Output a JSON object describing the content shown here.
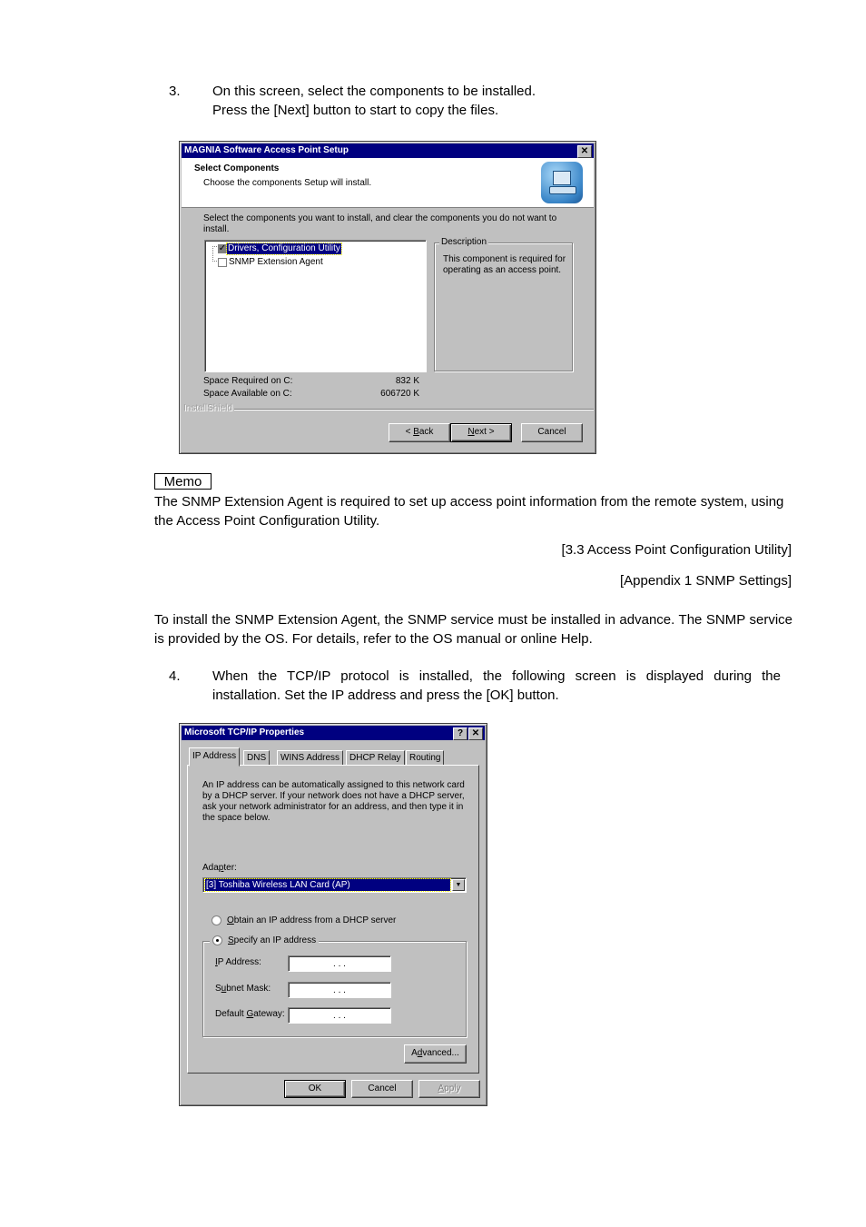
{
  "step3": {
    "number": "3.",
    "line1": "On this screen, select the components to be installed.",
    "line2": "Press the [Next] button to start to copy the files."
  },
  "setup_dialog": {
    "title": "MAGNIA Software Access Point Setup",
    "close_glyph": "✕",
    "header_title": "Select Components",
    "header_subtitle": "Choose the components Setup will install.",
    "instructions": "Select the components you want to install, and clear the components you do not want to install.",
    "components": [
      {
        "label": "Drivers, Configuration Utility",
        "checked": true,
        "selected": true
      },
      {
        "label": "SNMP Extension Agent",
        "checked": false,
        "selected": false
      }
    ],
    "description_label": "Description",
    "description_text": "This component is required for operating as an access point.",
    "space_required_label": "Space Required on  C:",
    "space_required_value": "832 K",
    "space_available_label": "Space Available on  C:",
    "space_available_value": "606720 K",
    "brand_label": "InstallShield",
    "back_button": {
      "prefix": "< ",
      "accel": "B",
      "rest": "ack"
    },
    "next_button": {
      "accel": "N",
      "rest": "ext >"
    },
    "cancel_button": "Cancel"
  },
  "memo": {
    "label": "Memo",
    "text": "The SNMP Extension Agent is required to set up access point information from the remote system, using the Access Point Configuration Utility.",
    "ref1": "[3.3 Access Point Configuration Utility]",
    "ref2": "[Appendix 1   SNMP Settings]"
  },
  "snmp_note": "To install the SNMP Extension Agent, the SNMP service must be installed in advance.  The SNMP service is provided by the OS.  For details, refer to the OS manual or online Help.",
  "step4": {
    "number": "4.",
    "line1": "When the TCP/IP protocol is installed, the following screen is displayed during the",
    "line2": "installation.  Set the IP address and press the [OK] button."
  },
  "tcpip_dialog": {
    "title": "Microsoft TCP/IP Properties",
    "help_glyph": "?",
    "close_glyph": "✕",
    "tabs": [
      "IP Address",
      "DNS",
      "WINS Address",
      "DHCP Relay",
      "Routing"
    ],
    "active_tab": "IP Address",
    "intro": "An IP address can be automatically assigned to this network card by a DHCP server.  If your network does not have a DHCP server, ask your network administrator for an address, and then type it in the space below.",
    "adapter_label": {
      "pre": "Ada",
      "accel": "p",
      "post": "ter:"
    },
    "adapter_value": "[3] Toshiba Wireless LAN Card (AP)",
    "radio_dhcp": {
      "accel": "O",
      "rest": "btain an IP address from a DHCP server",
      "selected": false
    },
    "radio_specify": {
      "accel": "S",
      "rest": "pecify an IP address",
      "selected": true
    },
    "ip_address_label": {
      "pre": "",
      "accel": "I",
      "post": "P Address:"
    },
    "subnet_label": {
      "pre": "S",
      "accel": "u",
      "post": "bnet Mask:"
    },
    "gateway_label": {
      "pre": "Default ",
      "accel": "G",
      "post": "ateway:"
    },
    "ip_dots": ".       .       .",
    "advanced_button": {
      "pre": "A",
      "accel": "d",
      "post": "vanced..."
    },
    "ok_button": "OK",
    "cancel_button": "Cancel",
    "apply_button": {
      "accel": "A",
      "rest": "pply"
    }
  }
}
